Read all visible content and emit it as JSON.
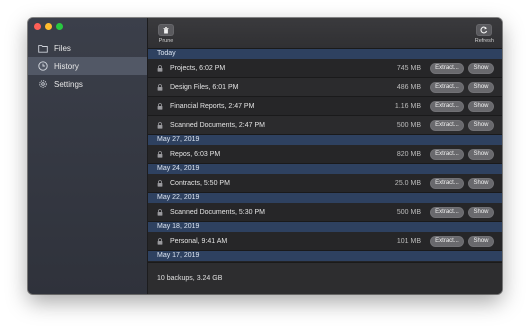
{
  "window": {
    "traffic_lights": [
      "#fe5f57",
      "#febc2e",
      "#28c840"
    ]
  },
  "sidebar": {
    "items": [
      {
        "label": "Files",
        "icon": "folder-icon",
        "active": false
      },
      {
        "label": "History",
        "icon": "clock-icon",
        "active": true
      },
      {
        "label": "Settings",
        "icon": "gear-icon",
        "active": false
      }
    ]
  },
  "toolbar": {
    "prune_label": "Prune",
    "prune_icon": "trash-icon",
    "refresh_label": "Refresh",
    "refresh_icon": "refresh-icon"
  },
  "sections": [
    {
      "header": "Today",
      "rows": [
        {
          "name": "Projects, 6:02 PM",
          "size": "745 MB"
        },
        {
          "name": "Design Files, 6:01 PM",
          "size": "486 MB"
        },
        {
          "name": "Financial Reports, 2:47 PM",
          "size": "1.16 MB"
        },
        {
          "name": "Scanned Documents, 2:47 PM",
          "size": "500 MB"
        }
      ]
    },
    {
      "header": "May 27, 2019",
      "rows": [
        {
          "name": "Repos, 6:03 PM",
          "size": "820 MB"
        }
      ]
    },
    {
      "header": "May 24, 2019",
      "rows": [
        {
          "name": "Contracts, 5:50 PM",
          "size": "25.0 MB"
        }
      ]
    },
    {
      "header": "May 22, 2019",
      "rows": [
        {
          "name": "Scanned Documents, 5:30 PM",
          "size": "500 MB"
        }
      ]
    },
    {
      "header": "May 18, 2019",
      "rows": [
        {
          "name": "Personal, 9:41 AM",
          "size": "101 MB"
        }
      ]
    },
    {
      "header": "May 17, 2019",
      "rows": []
    }
  ],
  "row_buttons": {
    "extract_label": "Extract...",
    "show_label": "Show"
  },
  "footer": {
    "summary": "10 backups, 3.24 GB"
  },
  "colors": {
    "section_header_bg": "#2e4160",
    "sidebar_active": "#525866",
    "button_bg": "#69696d"
  }
}
